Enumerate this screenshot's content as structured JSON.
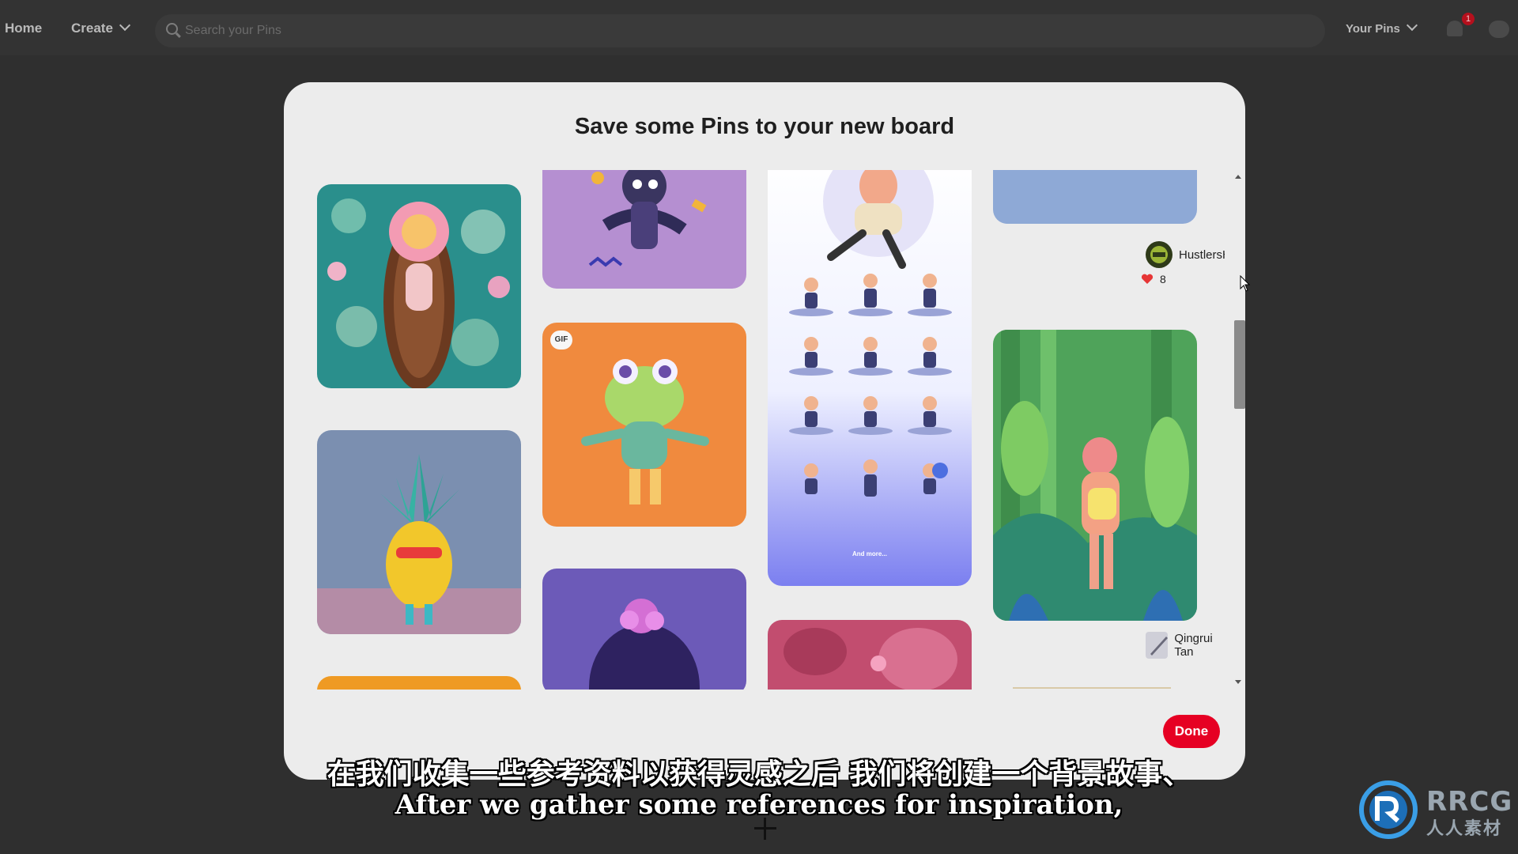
{
  "nav": {
    "home": "Home",
    "create": "Create",
    "search_placeholder": "Search your Pins",
    "your_pins": "Your Pins",
    "notification_count": "1"
  },
  "modal": {
    "title": "Save some Pins to your new board",
    "done_label": "Done",
    "gif_label": "GIF",
    "pins": [
      {
        "creator": "HustlersHold",
        "likes": "8"
      },
      {
        "creator": "Qingrui Tan"
      }
    ],
    "mini_caption": "And more..."
  },
  "subtitles": {
    "chinese": "在我们收集一些参考资料以获得灵感之后 我们将创建一个背景故事、",
    "english": "After we gather some references for inspiration,"
  },
  "watermark": {
    "brand": "RRCG",
    "chinese": "人人素材"
  },
  "colors": {
    "accent": "#e60023",
    "modal_bg": "#ececec",
    "backdrop": "#2f2f2f"
  }
}
